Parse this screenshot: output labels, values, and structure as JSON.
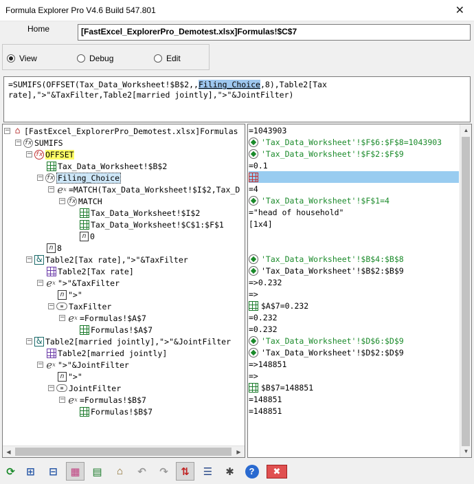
{
  "window": {
    "title": "Formula Explorer Pro V4.6 Build 547.801",
    "close_glyph": "✕"
  },
  "home": {
    "label": "Home",
    "path": "[FastExcel_ExplorerPro_Demotest.xlsx]Formulas!$C$7"
  },
  "modes": [
    {
      "label": "View",
      "checked": true
    },
    {
      "label": "Debug",
      "checked": false
    },
    {
      "label": "Edit",
      "checked": false
    }
  ],
  "formula": {
    "before": "=SUMIFS(OFFSET(Tax_Data_Worksheet!$B$2,,",
    "highlight": "Filing_Choice",
    "after": ",8),Table2[Tax\nrate],\">\"&TaxFilter,Table2[married jointly],\">\"&JointFilter)"
  },
  "tree": [
    {
      "text": "[FastExcel_ExplorerPro_Demotest.xlsx]Formulas",
      "icon": "home-icon"
    },
    {
      "text": "SUMIFS",
      "icon": "function-icon"
    },
    {
      "text": "OFFSET",
      "icon": "function-icon"
    },
    {
      "text": "Tax_Data_Worksheet!$B$2",
      "icon": "range-icon"
    },
    {
      "text": "Filing_Choice",
      "icon": "named-function-icon"
    },
    {
      "text": "=MATCH(Tax_Data_Worksheet!$I$2,Tax_D",
      "icon": "expression-icon"
    },
    {
      "text": "MATCH",
      "icon": "function-icon"
    },
    {
      "text": "Tax_Data_Worksheet!$I$2",
      "icon": "range-icon"
    },
    {
      "text": "Tax_Data_Worksheet!$C$1:$F$1",
      "icon": "range-icon"
    },
    {
      "text": "0",
      "icon": "number-icon"
    },
    {
      "text": "8",
      "icon": "number-icon"
    },
    {
      "text": "Table2[Tax rate],\">\"&TaxFilter",
      "icon": "concat-icon"
    },
    {
      "text": "Table2[Tax rate]",
      "icon": "table-icon"
    },
    {
      "text": "\">\"&TaxFilter",
      "icon": "expression-icon"
    },
    {
      "text": "\">\"",
      "icon": "number-icon"
    },
    {
      "text": "TaxFilter",
      "icon": "name-icon"
    },
    {
      "text": "=Formulas!$A$7",
      "icon": "expression-icon"
    },
    {
      "text": "Formulas!$A$7",
      "icon": "range-icon"
    },
    {
      "text": "Table2[married jointly],\">\"&JointFilter",
      "icon": "concat-icon"
    },
    {
      "text": "Table2[married jointly]",
      "icon": "table-icon"
    },
    {
      "text": "\">\"&JointFilter",
      "icon": "expression-icon"
    },
    {
      "text": "\">\"",
      "icon": "number-icon"
    },
    {
      "text": "JointFilter",
      "icon": "name-icon"
    },
    {
      "text": "=Formulas!$B$7",
      "icon": "expression-icon"
    },
    {
      "text": "Formulas!$B$7",
      "icon": "range-icon"
    }
  ],
  "results": [
    {
      "text": "=1043903"
    },
    {
      "text": "'Tax_Data_Worksheet'!$F$6:$F$8=1043903",
      "icon": "reference-icon"
    },
    {
      "text": "'Tax_Data_Worksheet'!$F$2:$F$9",
      "icon": "reference-icon"
    },
    {
      "text": "=0.1"
    },
    {
      "text": "",
      "icon": "range-red-icon"
    },
    {
      "text": "=4"
    },
    {
      "text": "'Tax_Data_Worksheet'!$F$1=4",
      "icon": "reference-icon"
    },
    {
      "text": "=\"head of household\""
    },
    {
      "text": "[1x4]"
    },
    {
      "text": ""
    },
    {
      "text": ""
    },
    {
      "text": "'Tax_Data_Worksheet'!$B$4:$B$8",
      "icon": "reference-icon"
    },
    {
      "text": "'Tax_Data_Worksheet'!$B$2:$B$9",
      "icon": "reference-icon"
    },
    {
      "text": "=>0.232"
    },
    {
      "text": "=>"
    },
    {
      "text": "$A$7=0.232",
      "icon": "range-icon"
    },
    {
      "text": "=0.232"
    },
    {
      "text": "=0.232"
    },
    {
      "text": "'Tax_Data_Worksheet'!$D$6:$D$9",
      "icon": "reference-icon"
    },
    {
      "text": "'Tax_Data_Worksheet'!$D$2:$D$9",
      "icon": "reference-icon"
    },
    {
      "text": "=>148851"
    },
    {
      "text": "=>"
    },
    {
      "text": "$B$7=148851",
      "icon": "range-icon"
    },
    {
      "text": "=148851"
    },
    {
      "text": "=148851"
    }
  ],
  "toolbar": [
    {
      "icon": "refresh-icon",
      "glyph": "⟳"
    },
    {
      "icon": "expand-all-icon",
      "glyph": "⊞"
    },
    {
      "icon": "collapse-all-icon",
      "glyph": "⊟"
    },
    {
      "icon": "color-map-icon",
      "glyph": "▦"
    },
    {
      "icon": "sheet-view-icon",
      "glyph": "▤"
    },
    {
      "icon": "home-icon",
      "glyph": "⌂"
    },
    {
      "icon": "undo-icon",
      "glyph": "↶"
    },
    {
      "icon": "redo-icon",
      "glyph": "↷"
    },
    {
      "icon": "swap-direction-icon",
      "glyph": "⇅"
    },
    {
      "icon": "align-icon",
      "glyph": "☰"
    },
    {
      "icon": "settings-icon",
      "glyph": "✱"
    },
    {
      "icon": "help-icon",
      "glyph": "?"
    },
    {
      "icon": "close-icon",
      "glyph": "✖"
    }
  ],
  "colors": {
    "accent_blue": "#99ccf0",
    "offset_yellow": "#ffff66",
    "reference_green": "#1a8a2a"
  }
}
